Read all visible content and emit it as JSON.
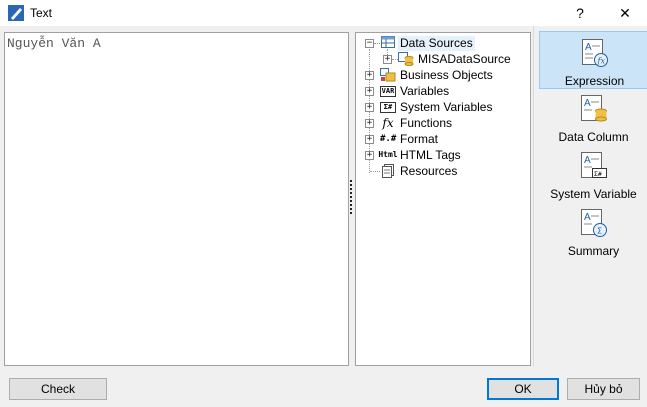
{
  "window": {
    "title": "Text",
    "help_label": "?",
    "close_label": "✕"
  },
  "editor": {
    "value": "Nguyễn Văn A"
  },
  "tree": {
    "items": [
      {
        "label": "Data Sources",
        "icon": "table-icon",
        "expander": "−"
      },
      {
        "label": "MISADataSource",
        "icon": "database-icon",
        "expander": "+"
      },
      {
        "label": "Business Objects",
        "icon": "business-objects-icon",
        "expander": "+"
      },
      {
        "label": "Variables",
        "icon": "variable-icon",
        "icon_text": "VAR",
        "expander": "+"
      },
      {
        "label": "System Variables",
        "icon": "system-variable-icon",
        "icon_text": "Σ#",
        "expander": "+"
      },
      {
        "label": "Functions",
        "icon": "function-icon",
        "icon_text": "fx",
        "expander": "+"
      },
      {
        "label": "Format",
        "icon": "format-icon",
        "icon_text": "#.#",
        "expander": "+"
      },
      {
        "label": "HTML Tags",
        "icon": "html-icon",
        "icon_text": "Html",
        "expander": "+"
      },
      {
        "label": "Resources",
        "icon": "resources-icon"
      }
    ]
  },
  "right_panel": {
    "buttons": [
      {
        "label": "Expression",
        "icon": "expression-icon",
        "active": true
      },
      {
        "label": "Data Column",
        "icon": "data-column-icon"
      },
      {
        "label": "System Variable",
        "icon": "system-variable-icon"
      },
      {
        "label": "Summary",
        "icon": "summary-icon"
      }
    ]
  },
  "footer": {
    "check_label": "Check",
    "ok_label": "OK",
    "cancel_label": "Hủy bỏ"
  },
  "colors": {
    "accent": "#0078d7",
    "selected_bg": "#cce4f7",
    "icon_blue": "#2a66b6",
    "db_yellow": "#f0c040"
  }
}
